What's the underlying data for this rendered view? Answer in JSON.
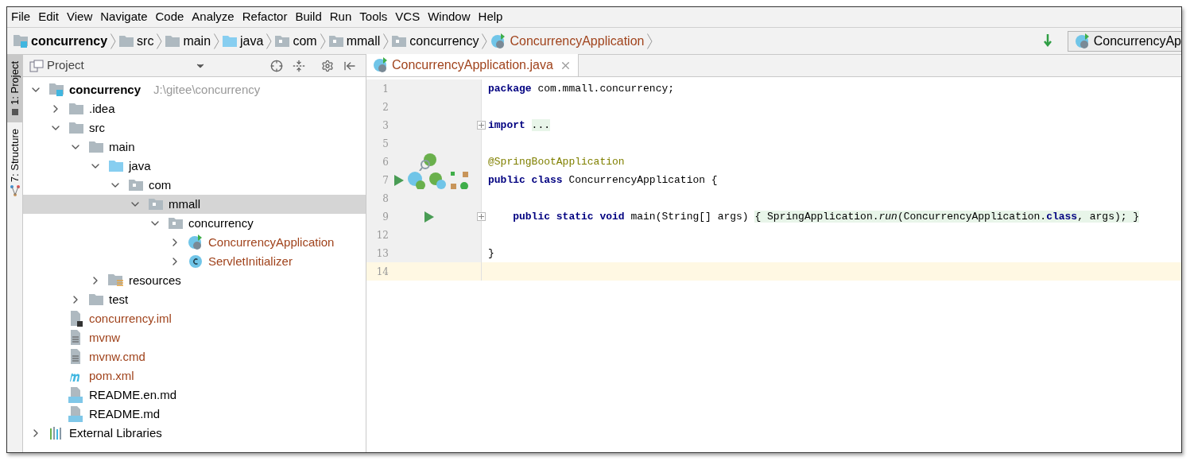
{
  "menu": [
    "File",
    "Edit",
    "View",
    "Navigate",
    "Code",
    "Analyze",
    "Refactor",
    "Build",
    "Run",
    "Tools",
    "VCS",
    "Window",
    "Help"
  ],
  "breadcrumbs": [
    {
      "label": "concurrency",
      "kind": "module",
      "bold": true,
      "unversioned": false
    },
    {
      "label": "src",
      "kind": "folder",
      "bold": false,
      "unversioned": false
    },
    {
      "label": "main",
      "kind": "folder",
      "bold": false,
      "unversioned": false
    },
    {
      "label": "java",
      "kind": "source",
      "bold": false,
      "unversioned": false
    },
    {
      "label": "com",
      "kind": "package",
      "bold": false,
      "unversioned": false
    },
    {
      "label": "mmall",
      "kind": "package",
      "bold": false,
      "unversioned": false
    },
    {
      "label": "concurrency",
      "kind": "package",
      "bold": false,
      "unversioned": false
    },
    {
      "label": "ConcurrencyApplication",
      "kind": "spring-class",
      "bold": false,
      "unversioned": true
    }
  ],
  "run_config": {
    "label": "ConcurrencyAp"
  },
  "tool_strip": [
    {
      "label": "1: Project",
      "kind": "project",
      "selected": true
    },
    {
      "label": "7: Structure",
      "kind": "structure",
      "selected": false
    }
  ],
  "project_panel": {
    "title": "Project"
  },
  "tree": [
    {
      "label": "concurrency",
      "path": "J:\\gitee\\concurrency",
      "kind": "module",
      "expanded": true,
      "selected": false,
      "unversioned": false,
      "children": [
        {
          "label": ".idea",
          "kind": "folder",
          "expanded": false,
          "selected": false,
          "unversioned": false
        },
        {
          "label": "src",
          "kind": "folder",
          "expanded": true,
          "selected": false,
          "unversioned": false,
          "children": [
            {
              "label": "main",
              "kind": "folder",
              "expanded": true,
              "selected": false,
              "unversioned": false,
              "children": [
                {
                  "label": "java",
                  "kind": "source",
                  "expanded": true,
                  "selected": false,
                  "unversioned": false,
                  "children": [
                    {
                      "label": "com",
                      "kind": "package",
                      "expanded": true,
                      "selected": false,
                      "unversioned": false,
                      "children": [
                        {
                          "label": "mmall",
                          "kind": "package",
                          "expanded": true,
                          "selected": true,
                          "unversioned": false,
                          "children": [
                            {
                              "label": "concurrency",
                              "kind": "package",
                              "expanded": true,
                              "selected": false,
                              "unversioned": false,
                              "children": [
                                {
                                  "label": "ConcurrencyApplication",
                                  "kind": "spring-class",
                                  "expanded": false,
                                  "selected": false,
                                  "unversioned": true
                                },
                                {
                                  "label": "ServletInitializer",
                                  "kind": "class",
                                  "expanded": false,
                                  "selected": false,
                                  "unversioned": true
                                }
                              ]
                            }
                          ]
                        }
                      ]
                    }
                  ]
                },
                {
                  "label": "resources",
                  "kind": "resources",
                  "expanded": false,
                  "selected": false,
                  "unversioned": false
                }
              ]
            },
            {
              "label": "test",
              "kind": "folder",
              "expanded": false,
              "selected": false,
              "unversioned": false
            }
          ]
        },
        {
          "label": "concurrency.iml",
          "kind": "iml",
          "selected": false,
          "unversioned": true
        },
        {
          "label": "mvnw",
          "kind": "text",
          "selected": false,
          "unversioned": true
        },
        {
          "label": "mvnw.cmd",
          "kind": "text",
          "selected": false,
          "unversioned": true
        },
        {
          "label": "pom.xml",
          "kind": "maven",
          "selected": false,
          "unversioned": true
        },
        {
          "label": "README.en.md",
          "kind": "md",
          "selected": false,
          "unversioned": false
        },
        {
          "label": "README.md",
          "kind": "md",
          "selected": false,
          "unversioned": false
        }
      ]
    },
    {
      "label": "External Libraries",
      "kind": "libraries",
      "expanded": false,
      "selected": false,
      "unversioned": false
    }
  ],
  "editor_tabs": [
    {
      "label": "ConcurrencyApplication.java",
      "kind": "spring-class",
      "selected": true,
      "unversioned": true
    }
  ],
  "code": [
    {
      "number": "1",
      "current": false,
      "fold": false,
      "tokens": [
        {
          "kind": "keyword",
          "text": "package"
        },
        {
          "kind": "plain",
          "text": " com.mmall.concurrency;"
        }
      ]
    },
    {
      "number": "2",
      "current": false,
      "fold": false
    },
    {
      "number": "3",
      "current": false,
      "fold": true,
      "tokens": [
        {
          "kind": "keyword",
          "text": "import "
        },
        {
          "kind": "folded",
          "text": "..."
        }
      ]
    },
    {
      "number": "5",
      "current": false,
      "fold": false
    },
    {
      "number": "6",
      "current": false,
      "fold": false,
      "gutter": [
        {
          "kind": "bean-search"
        }
      ],
      "tokens": [
        {
          "kind": "annotation",
          "text": "@SpringBootApplication"
        }
      ]
    },
    {
      "number": "7",
      "current": false,
      "fold": false,
      "gutter": [
        {
          "kind": "run"
        },
        {
          "kind": "spring-class"
        },
        {
          "kind": "spring-config"
        },
        {
          "kind": "diagram"
        }
      ],
      "tokens": [
        {
          "kind": "keyword",
          "text": "public class"
        },
        {
          "kind": "plain",
          "text": " ConcurrencyApplication {"
        }
      ]
    },
    {
      "number": "8",
      "current": false,
      "fold": false
    },
    {
      "number": "9",
      "current": false,
      "fold": true,
      "gutter": [
        {
          "kind": "run-method"
        }
      ],
      "tokens": [
        {
          "kind": "keyword",
          "text": "    public static void"
        },
        {
          "kind": "plain",
          "text": " main(String[] args) "
        },
        {
          "kind": "folded",
          "text": "{ SpringApplication."
        },
        {
          "kind": "folded-italic",
          "text": "run"
        },
        {
          "kind": "folded",
          "text": "(ConcurrencyApplication."
        },
        {
          "kind": "folded-keyword",
          "text": "class"
        },
        {
          "kind": "folded",
          "text": ", args); }"
        }
      ]
    },
    {
      "number": "12",
      "current": false,
      "fold": false
    },
    {
      "number": "13",
      "current": false,
      "fold": false,
      "tokens": [
        {
          "kind": "plain",
          "text": "}"
        }
      ]
    },
    {
      "number": "14",
      "current": true,
      "fold": false
    }
  ]
}
